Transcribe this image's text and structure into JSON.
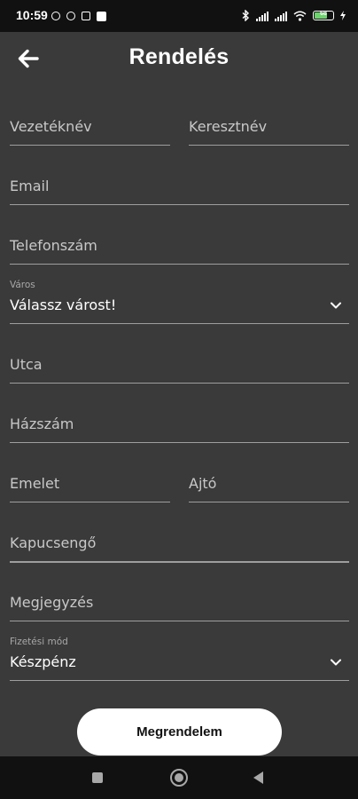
{
  "status_bar": {
    "time": "10:59",
    "battery_percent": "68",
    "left_icons": [
      "alarm-icon",
      "app-icon",
      "gmail-icon",
      "notification-icon"
    ],
    "right_icons": [
      "bluetooth-icon",
      "signal-icon",
      "signal-icon",
      "wifi-icon",
      "battery-icon",
      "charging-icon"
    ]
  },
  "header": {
    "title": "Rendelés",
    "back_icon": "arrow-left-icon"
  },
  "form": {
    "last_name": {
      "placeholder": "Vezetéknév"
    },
    "first_name": {
      "placeholder": "Keresztnév"
    },
    "email": {
      "placeholder": "Email"
    },
    "phone": {
      "placeholder": "Telefonszám"
    },
    "city": {
      "label": "Város",
      "value": "Válassz várost!"
    },
    "street": {
      "placeholder": "Utca"
    },
    "house_number": {
      "placeholder": "Házszám"
    },
    "floor": {
      "placeholder": "Emelet"
    },
    "door": {
      "placeholder": "Ajtó"
    },
    "doorbell": {
      "placeholder": "Kapucsengő"
    },
    "note": {
      "placeholder": "Megjegyzés"
    },
    "payment": {
      "label": "Fizetési mód",
      "value": "Készpénz"
    }
  },
  "submit": {
    "label": "Megrendelem"
  },
  "nav_bar": {
    "icons": [
      "recent-apps-icon",
      "home-icon",
      "back-icon"
    ]
  },
  "colors": {
    "background": "#3a3a3a",
    "status_bar": "#111111",
    "underline": "#9e9e9e",
    "button_bg": "#ffffff",
    "button_text": "#111111",
    "battery_fill": "#6dd36d"
  }
}
